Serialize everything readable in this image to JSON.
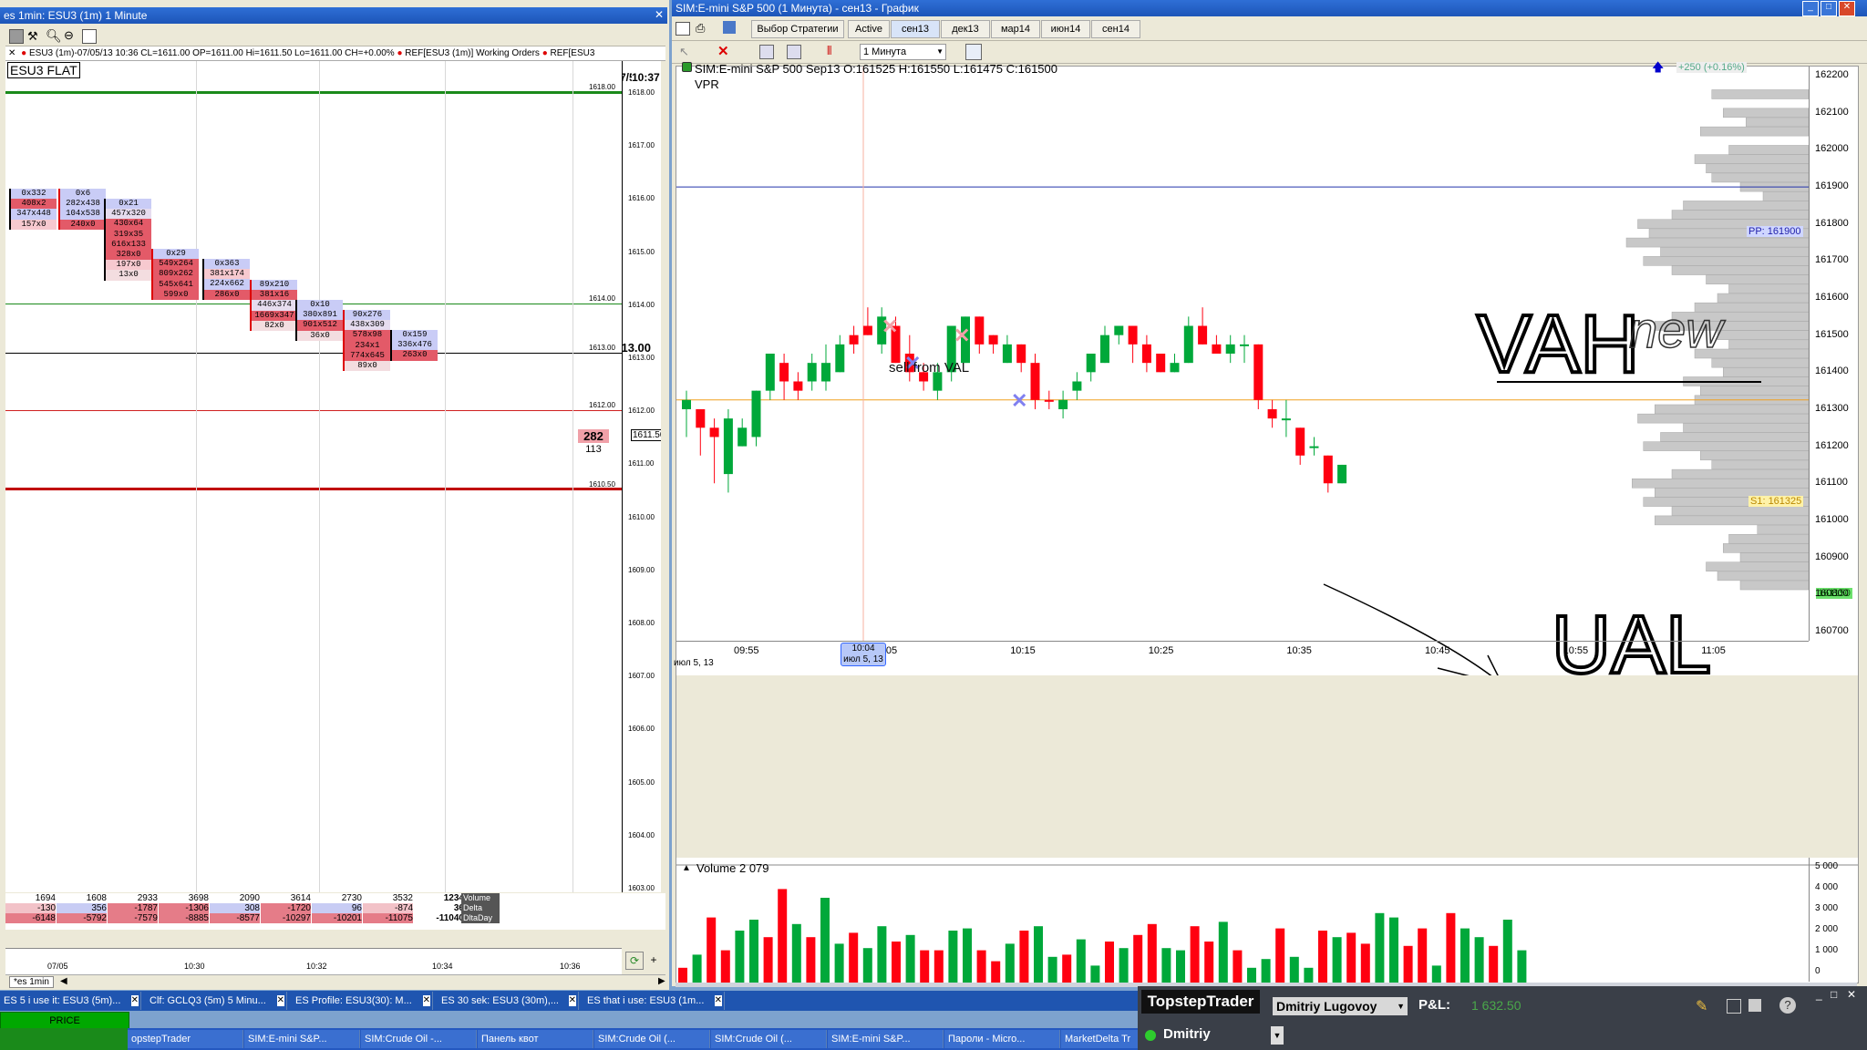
{
  "left": {
    "title": "es 1min: ESU3 (1m) 1 Minute",
    "info_line": "ESU3 (1m)-07/05/13 10:36 CL=1611.00 OP=1611.00 Hi=1611.50 Lo=1611.00 CH=+0.00%",
    "working_orders": "REF[ESU3 (1m)] Working Orders",
    "ref2": "REF[ESU3",
    "instrument_box": "ESU3 FLAT",
    "clock": "10:37",
    "clock_date": "7/5",
    "price_labels": [
      "1618.00",
      "1617.00",
      "1616.00",
      "1615.00",
      "1614.00",
      "1613.00",
      "1612.00",
      "1611.00",
      "1610.00",
      "1609.00",
      "1608.00",
      "1607.00",
      "1606.00",
      "1605.00",
      "1604.00",
      "1603.00"
    ],
    "level_labels": [
      "1618.00",
      "1614.00",
      "1613.00",
      "1612.00",
      "1610.50",
      "1611.50"
    ],
    "current_price_big": "1613.00",
    "footprint_cols": [
      {
        "rows": [
          "0x332",
          "408x2",
          "347x448",
          "157x0"
        ]
      },
      {
        "rows": [
          "0x6",
          "282x438",
          "104x538",
          "240x0"
        ]
      },
      {
        "rows": [
          "0x21",
          "457x320",
          "430x64",
          "319x35",
          "616x133",
          "328x0",
          "197x0",
          "13x0"
        ]
      },
      {
        "rows": [
          "0x29",
          "549x264",
          "809x262",
          "545x641",
          "599x0"
        ]
      },
      {
        "rows": [
          "0x363",
          "381x174",
          "224x662",
          "286x0"
        ]
      },
      {
        "rows": [
          "89x210",
          "381x16",
          "446x374",
          "1669x347",
          "82x0"
        ]
      },
      {
        "rows": [
          "0x10",
          "380x891",
          "901x512",
          "36x0"
        ]
      },
      {
        "rows": [
          "90x276",
          "438x309",
          "578x98",
          "234x1",
          "774x645",
          "89x0"
        ]
      },
      {
        "rows": [
          "0x159",
          "336x476",
          "263x0"
        ]
      }
    ],
    "last_cell": {
      "top": "282",
      "bottom": "113"
    },
    "summary": {
      "volume": [
        "1694",
        "1608",
        "2933",
        "3698",
        "2090",
        "3614",
        "2730",
        "3532",
        "1234"
      ],
      "delta": [
        "-130",
        "356",
        "-1787",
        "-1306",
        "308",
        "-1720",
        "96",
        "-874",
        "36"
      ],
      "dltaday": [
        "-6148",
        "-5792",
        "-7579",
        "-8885",
        "-8577",
        "-10297",
        "-10201",
        "-11075",
        "-11040"
      ],
      "labels": [
        "Volume",
        "Delta",
        "DltaDay"
      ]
    },
    "time_labels": [
      "07/05",
      "10:30",
      "10:32",
      "10:34",
      "10:36"
    ],
    "bottom_tab": "*es 1min"
  },
  "right": {
    "title": "SIM:E-mini S&P 500 (1 Минута) - сен13 - График",
    "strategy_btn": "Выбор Стратегии",
    "tabs": [
      "Active",
      "сен13",
      "дек13",
      "мар14",
      "июн14",
      "сен14"
    ],
    "interval": "1 Минута",
    "chart_header": "SIM:E-mini S&P 500 Sep13  O:161525 H:161550 L:161475 C:161500",
    "vpr": "VPR",
    "annotation_text": "sell from VAL",
    "ink_vah": "VAH",
    "ink_new": "new",
    "ink_val": "UAL",
    "pp_label": "PP: 161900",
    "s1_label": "S1: 161325",
    "last_price": "161150",
    "change_badge": "+250 (+0.16%)",
    "price_axis": [
      "162200",
      "162100",
      "162000",
      "161900",
      "161800",
      "161700",
      "161600",
      "161500",
      "161400",
      "161300",
      "161200",
      "161100",
      "161000",
      "160900",
      "160800",
      "160700"
    ],
    "time_axis": [
      "09:55",
      "10:05",
      "10:15",
      "10:25",
      "10:35",
      "10:45",
      "10:55",
      "11:05"
    ],
    "time_date": "июл 5, 13",
    "cursor_time": "10:04",
    "cursor_date": "июл 5, 13",
    "volume_label": "Volume  2 079",
    "vol_axis": [
      "5 000",
      "4 000",
      "3 000",
      "2 000",
      "1 000",
      "0"
    ]
  },
  "chart_data": {
    "type": "candlestick",
    "title": "SIM:E-mini S&P 500 Sep13",
    "ylim": [
      160700,
      162200
    ],
    "candles": [
      [
        161325,
        161300,
        161350,
        161225,
        "up"
      ],
      [
        161250,
        161300,
        161300,
        161175,
        "down"
      ],
      [
        161225,
        161250,
        161275,
        161100,
        "down"
      ],
      [
        161125,
        161275,
        161300,
        161075,
        "up"
      ],
      [
        161200,
        161250,
        161275,
        161200,
        "up"
      ],
      [
        161225,
        161350,
        161350,
        161200,
        "up"
      ],
      [
        161350,
        161450,
        161450,
        161325,
        "up"
      ],
      [
        161425,
        161375,
        161450,
        161325,
        "down"
      ],
      [
        161375,
        161350,
        161400,
        161325,
        "down"
      ],
      [
        161425,
        161375,
        161450,
        161350,
        "up"
      ],
      [
        161375,
        161425,
        161475,
        161350,
        "up"
      ],
      [
        161400,
        161475,
        161500,
        161400,
        "up"
      ],
      [
        161500,
        161475,
        161525,
        161450,
        "down"
      ],
      [
        161525,
        161500,
        161575,
        161500,
        "down"
      ],
      [
        161475,
        161550,
        161575,
        161450,
        "up"
      ],
      [
        161525,
        161425,
        161550,
        161425,
        "down"
      ],
      [
        161450,
        161400,
        161500,
        161375,
        "down"
      ],
      [
        161400,
        161375,
        161425,
        161350,
        "down"
      ],
      [
        161350,
        161400,
        161425,
        161325,
        "up"
      ],
      [
        161400,
        161525,
        161525,
        161375,
        "up"
      ],
      [
        161425,
        161550,
        161550,
        161425,
        "up"
      ],
      [
        161550,
        161475,
        161550,
        161450,
        "down"
      ],
      [
        161475,
        161500,
        161500,
        161450,
        "down"
      ],
      [
        161425,
        161475,
        161500,
        161425,
        "up"
      ],
      [
        161475,
        161425,
        161475,
        161400,
        "down"
      ],
      [
        161425,
        161325,
        161450,
        161300,
        "down"
      ],
      [
        161325,
        161325,
        161350,
        161300,
        "down"
      ],
      [
        161325,
        161300,
        161350,
        161275,
        "up"
      ],
      [
        161350,
        161375,
        161400,
        161325,
        "up"
      ],
      [
        161400,
        161450,
        161450,
        161375,
        "up"
      ],
      [
        161425,
        161500,
        161525,
        161425,
        "up"
      ],
      [
        161500,
        161525,
        161525,
        161475,
        "up"
      ],
      [
        161525,
        161475,
        161525,
        161425,
        "down"
      ],
      [
        161475,
        161425,
        161500,
        161400,
        "down"
      ],
      [
        161450,
        161400,
        161450,
        161400,
        "down"
      ],
      [
        161400,
        161425,
        161450,
        161400,
        "up"
      ],
      [
        161425,
        161525,
        161550,
        161425,
        "up"
      ],
      [
        161525,
        161475,
        161575,
        161475,
        "down"
      ],
      [
        161475,
        161450,
        161500,
        161450,
        "down"
      ],
      [
        161450,
        161475,
        161500,
        161425,
        "up"
      ],
      [
        161475,
        161475,
        161500,
        161425,
        "up"
      ],
      [
        161475,
        161325,
        161475,
        161300,
        "down"
      ],
      [
        161300,
        161275,
        161325,
        161250,
        "down"
      ],
      [
        161275,
        161275,
        161325,
        161225,
        "up"
      ],
      [
        161250,
        161175,
        161250,
        161150,
        "down"
      ],
      [
        161200,
        161200,
        161225,
        161175,
        "up"
      ],
      [
        161175,
        161100,
        161175,
        161075,
        "down"
      ],
      [
        161100,
        161150,
        161150,
        161100,
        "up"
      ]
    ],
    "volume": [
      1300,
      1900,
      3600,
      2100,
      3000,
      3500,
      2700,
      4900,
      3300,
      2700,
      4500,
      2400,
      2900,
      2200,
      3200,
      2500,
      2800,
      2100,
      2100,
      3000,
      3100,
      2100,
      1600,
      2400,
      3000,
      3200,
      1800,
      1900,
      2600,
      1400,
      2500,
      2200,
      2800,
      3300,
      2200,
      2100,
      3200,
      2500,
      3400,
      2100,
      1300,
      1700,
      3100,
      1800,
      1300,
      3000,
      2700,
      2900,
      2400,
      3800,
      3600,
      2300,
      3100,
      1400,
      3800,
      3100,
      2700,
      2300,
      3500,
      2100
    ],
    "vol_ylim": [
      0,
      5000
    ],
    "pp": 161900,
    "s1": 161325,
    "last": 161150,
    "profile": [
      [
        162150,
        85
      ],
      [
        162100,
        75
      ],
      [
        162075,
        55
      ],
      [
        162050,
        95
      ],
      [
        162000,
        70
      ],
      [
        161975,
        100
      ],
      [
        161950,
        90
      ],
      [
        161925,
        85
      ],
      [
        161900,
        60
      ],
      [
        161875,
        40
      ],
      [
        161850,
        110
      ],
      [
        161825,
        120
      ],
      [
        161800,
        150
      ],
      [
        161775,
        140
      ],
      [
        161750,
        160
      ],
      [
        161725,
        130
      ],
      [
        161700,
        145
      ],
      [
        161675,
        120
      ],
      [
        161650,
        90
      ],
      [
        161625,
        70
      ],
      [
        161600,
        80
      ],
      [
        161575,
        100
      ],
      [
        161550,
        120
      ],
      [
        161525,
        135
      ],
      [
        161500,
        80
      ],
      [
        161475,
        70
      ],
      [
        161450,
        100
      ],
      [
        161425,
        85
      ],
      [
        161400,
        75
      ],
      [
        161375,
        110
      ],
      [
        161350,
        95
      ],
      [
        161325,
        100
      ],
      [
        161300,
        135
      ],
      [
        161275,
        150
      ],
      [
        161250,
        110
      ],
      [
        161225,
        130
      ],
      [
        161200,
        145
      ],
      [
        161175,
        95
      ],
      [
        161150,
        85
      ],
      [
        161125,
        120
      ],
      [
        161100,
        155
      ],
      [
        161075,
        135
      ],
      [
        161050,
        145
      ],
      [
        161025,
        120
      ],
      [
        161000,
        135
      ],
      [
        160975,
        45
      ],
      [
        160950,
        70
      ],
      [
        160925,
        75
      ],
      [
        160900,
        60
      ],
      [
        160875,
        90
      ],
      [
        160850,
        80
      ],
      [
        160825,
        60
      ]
    ]
  },
  "taskbar": {
    "tabs": [
      "ES 5 i use it: ESU3 (5m)...",
      "Clf: GCLQ3 (5m) 5 Minu...",
      "ES Profile: ESU3(30): M...",
      "ES 30 sek: ESU3 (30m),...",
      "ES that i use: ESU3 (1m..."
    ],
    "price_btn": "PRICE",
    "apps": [
      "opstepTrader",
      "SIM:E-mini S&P...",
      "SIM:Crude Oil -...",
      "Панель квот",
      "SIM:Crude Oil (...",
      "SIM:Crude Oil (...",
      "SIM:E-mini S&P...",
      "Пароли - Micro...",
      "MarketDelta Tr"
    ]
  },
  "topstep": {
    "brand": "TopstepTrader",
    "user": "Dmitriy Lugovoy",
    "pnl_label": "P&L:",
    "pnl_value": "1 632.50",
    "account": "Dmitriy"
  }
}
